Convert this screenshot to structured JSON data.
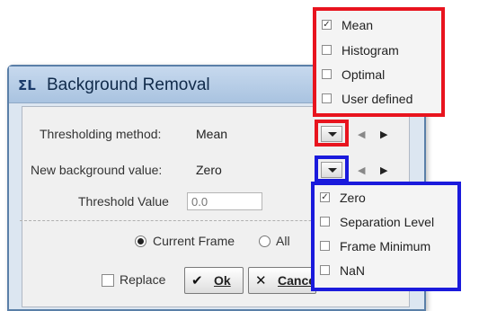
{
  "dialog": {
    "title_icon": "ΣL",
    "title": "Background Removal"
  },
  "form": {
    "threshold_method_label": "Thresholding method:",
    "threshold_method_value": "Mean",
    "bg_value_label": "New background value:",
    "bg_value_value": "Zero",
    "threshold_value_label": "Threshold Value",
    "threshold_value_placeholder": "0.0",
    "radio_current_label": "Current Frame",
    "radio_all_label": "All",
    "replace_label": "Replace",
    "ok_label": "Ok",
    "cancel_label": "Cancel"
  },
  "method_menu": {
    "items": [
      {
        "label": "Mean",
        "checked": true
      },
      {
        "label": "Histogram",
        "checked": false
      },
      {
        "label": "Optimal",
        "checked": false
      },
      {
        "label": "User defined",
        "checked": false
      }
    ]
  },
  "bg_menu": {
    "items": [
      {
        "label": "Zero",
        "checked": true
      },
      {
        "label": "Separation Level",
        "checked": false
      },
      {
        "label": "Frame Minimum",
        "checked": false
      },
      {
        "label": "NaN",
        "checked": false
      }
    ]
  },
  "colors": {
    "highlight_red": "#e8141e",
    "highlight_blue": "#1a1adc"
  },
  "icons": {
    "title": "sigma-icon",
    "ok": "check-icon",
    "cancel": "x-icon",
    "prev": "triangle-left-icon",
    "next": "triangle-right-icon"
  }
}
